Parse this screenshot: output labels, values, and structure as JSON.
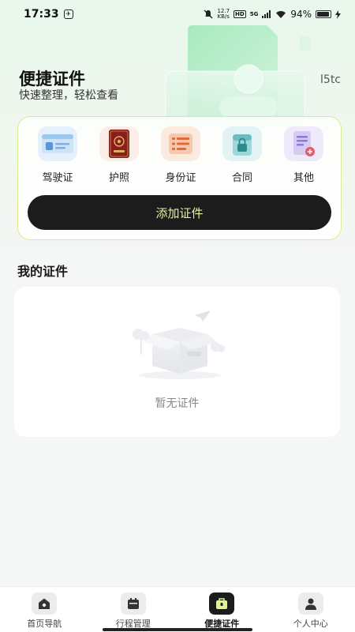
{
  "status_bar": {
    "time": "17:33",
    "notif_icon": "app-notification-icon",
    "speed_value": "12.7",
    "speed_unit": "KB/s",
    "hd_label": "HD",
    "network_label": "5G",
    "battery_percent": "94%",
    "battery_level": 0.94
  },
  "hero": {
    "title": "便捷证件",
    "subtitle": "快速整理，轻松查看",
    "tag": "l5tc"
  },
  "cert_types": [
    {
      "label": "驾驶证",
      "icon": "drivers-license-icon",
      "bg": "#e4f0fb"
    },
    {
      "label": "护照",
      "icon": "passport-icon",
      "bg": "#fbeee6"
    },
    {
      "label": "身份证",
      "icon": "id-card-icon",
      "bg": "#fbeae0"
    },
    {
      "label": "合同",
      "icon": "contract-icon",
      "bg": "#e3f3f4"
    },
    {
      "label": "其他",
      "icon": "other-docs-icon",
      "bg": "#efeaf9"
    }
  ],
  "add_button": {
    "label": "添加证件"
  },
  "my_certs": {
    "title": "我的证件",
    "empty_text": "暂无证件"
  },
  "bottom_nav": [
    {
      "label": "首页导航",
      "icon": "home-icon",
      "active": false
    },
    {
      "label": "行程管理",
      "icon": "itinerary-icon",
      "active": false
    },
    {
      "label": "便捷证件",
      "icon": "briefcase-icon",
      "active": true
    },
    {
      "label": "个人中心",
      "icon": "person-icon",
      "active": false
    }
  ],
  "colors": {
    "accent_text": "#e0f59a",
    "card_border": "#d7ec8e",
    "button_bg": "#1c1c1c"
  }
}
